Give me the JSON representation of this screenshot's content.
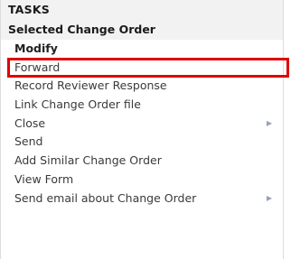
{
  "menu": {
    "header": "TASKS",
    "section_title": "Selected Change Order",
    "items": [
      {
        "label": "Modify",
        "bold": true,
        "submenu": false,
        "selected": false
      },
      {
        "label": "Forward",
        "bold": false,
        "submenu": false,
        "selected": true
      },
      {
        "label": "Record Reviewer Response",
        "bold": false,
        "submenu": false,
        "selected": false
      },
      {
        "label": "Link Change Order file",
        "bold": false,
        "submenu": false,
        "selected": false
      },
      {
        "label": "Close",
        "bold": false,
        "submenu": true,
        "selected": false
      },
      {
        "label": "Send",
        "bold": false,
        "submenu": false,
        "selected": false
      },
      {
        "label": "Add Similar Change Order",
        "bold": false,
        "submenu": false,
        "selected": false
      },
      {
        "label": "View Form",
        "bold": false,
        "submenu": false,
        "selected": false
      },
      {
        "label": "Send email about Change Order",
        "bold": false,
        "submenu": true,
        "selected": false
      }
    ],
    "submenu_icon": "chevron-right-icon",
    "highlight_color": "#e00000"
  }
}
